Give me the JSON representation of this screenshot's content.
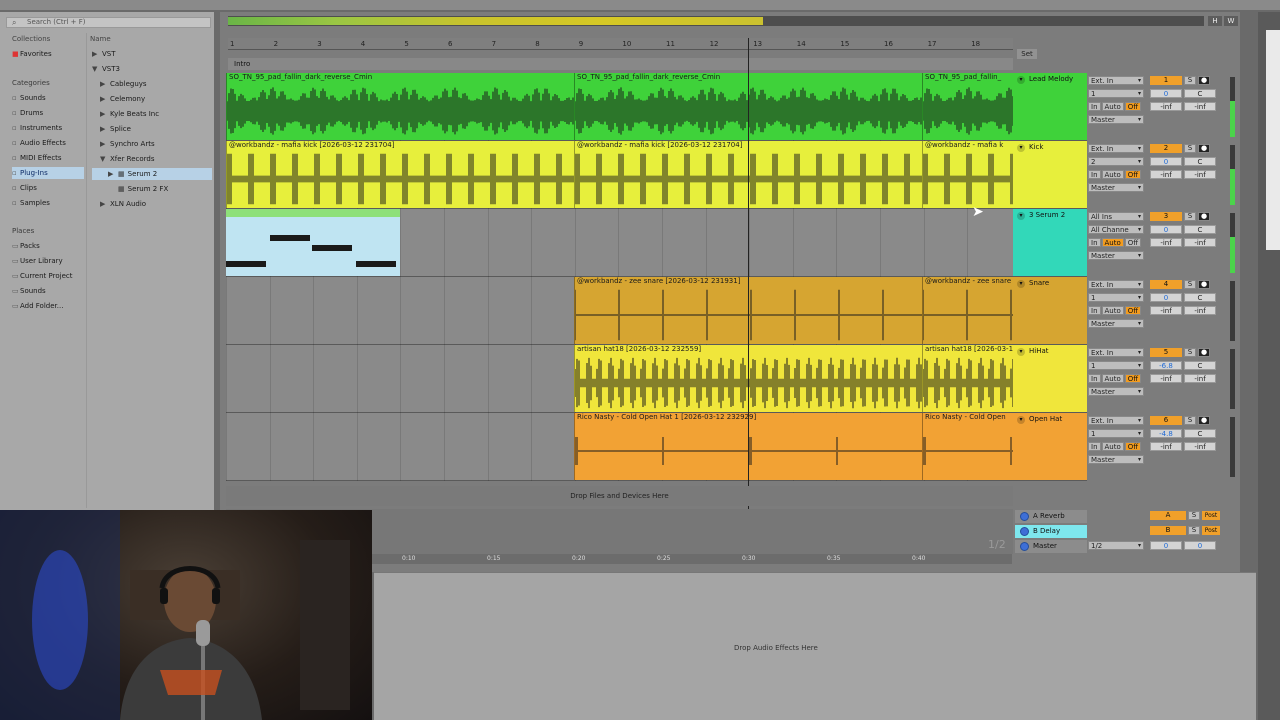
{
  "window": {
    "title": ""
  },
  "browser": {
    "search_placeholder": "Search (Ctrl + F)",
    "collections_label": "Collections",
    "name_column": "Name",
    "favorites": "Favorites",
    "categories_label": "Categories",
    "categories": [
      "Sounds",
      "Drums",
      "Instruments",
      "Audio Effects",
      "MIDI Effects",
      "Plug-Ins",
      "Clips",
      "Samples"
    ],
    "selected_category": "Plug-Ins",
    "places_label": "Places",
    "places": [
      "Packs",
      "User Library",
      "Current Project",
      "Sounds",
      "Add Folder..."
    ],
    "tree": [
      {
        "label": "VST",
        "indent": 0,
        "arrow": "▶"
      },
      {
        "label": "VST3",
        "indent": 0,
        "arrow": "▼"
      },
      {
        "label": "Cableguys",
        "indent": 1,
        "arrow": "▶"
      },
      {
        "label": "Celemony",
        "indent": 1,
        "arrow": "▶"
      },
      {
        "label": "Kyle Beats Inc",
        "indent": 1,
        "arrow": "▶"
      },
      {
        "label": "Splice",
        "indent": 1,
        "arrow": "▶"
      },
      {
        "label": "Synchro Arts",
        "indent": 1,
        "arrow": "▶"
      },
      {
        "label": "Xfer Records",
        "indent": 1,
        "arrow": "▼"
      },
      {
        "label": "Serum 2",
        "indent": 2,
        "arrow": "▶"
      },
      {
        "label": "Serum 2 FX",
        "indent": 2,
        "arrow": ""
      },
      {
        "label": "XLN Audio",
        "indent": 1,
        "arrow": "▶"
      }
    ]
  },
  "arrangement": {
    "bars": [
      "1",
      "2",
      "3",
      "4",
      "5",
      "6",
      "7",
      "8",
      "9",
      "10",
      "11",
      "12",
      "13",
      "14",
      "15",
      "16",
      "17",
      "18"
    ],
    "locator": "Intro",
    "set_label": "Set",
    "drop_files": "Drop Files and Devices Here",
    "page_indicator": "1/2",
    "overview_buttons": [
      "H",
      "W"
    ]
  },
  "tracks": [
    {
      "name": "Lead Melody",
      "num": "1",
      "color": "#3fd23a",
      "input": "Ext. In",
      "channel": "1",
      "output": "Master",
      "vol": "0",
      "pan": "C",
      "send": "-inf",
      "clips": [
        {
          "label": "SO_TN_95_pad_fallin_dark_reverse_Cmin",
          "start": 0,
          "end": 348
        },
        {
          "label": "SO_TN_95_pad_fallin_dark_reverse_Cmin",
          "start": 348,
          "end": 696
        },
        {
          "label": "SO_TN_95_pad_fallin_",
          "start": 696,
          "end": 787
        }
      ],
      "wave": "pad"
    },
    {
      "name": "Kick",
      "num": "2",
      "color": "#e7ef3c",
      "input": "Ext. In",
      "channel": "2",
      "output": "Master",
      "vol": "0",
      "pan": "C",
      "send": "-inf",
      "clips": [
        {
          "label": "@workbandz - mafia kick [2026-03-12 231704]",
          "start": 0,
          "end": 348
        },
        {
          "label": "@workbandz - mafia kick [2026-03-12 231704]",
          "start": 348,
          "end": 696
        },
        {
          "label": "@workbandz - mafia k",
          "start": 696,
          "end": 787
        }
      ],
      "wave": "kick"
    },
    {
      "name": "3 Serum 2",
      "num": "3",
      "color": "#32d8b9",
      "input": "All Ins",
      "channel": "All Channe",
      "output": "Master",
      "vol": "0",
      "pan": "C",
      "send": "-inf",
      "clips": [],
      "wave": "midi"
    },
    {
      "name": "Snare",
      "num": "4",
      "color": "#d6a531",
      "input": "Ext. In",
      "channel": "1",
      "output": "Master",
      "vol": "0",
      "pan": "C",
      "send": "-inf",
      "clips": [
        {
          "label": "@workbandz - zee snare [2026-03-12 231931]",
          "start": 348,
          "end": 696
        },
        {
          "label": "@workbandz - zee snare",
          "start": 696,
          "end": 787
        }
      ],
      "wave": "snare"
    },
    {
      "name": "HiHat",
      "num": "5",
      "color": "#f0e63b",
      "input": "Ext. In",
      "channel": "1",
      "output": "Master",
      "vol": "-6.8",
      "pan": "C",
      "send": "-inf",
      "clips": [
        {
          "label": "artisan hat18 [2026-03-12 232559]",
          "start": 348,
          "end": 696
        },
        {
          "label": "artisan hat18 [2026-03-12",
          "start": 696,
          "end": 787
        }
      ],
      "wave": "hat"
    },
    {
      "name": "Open Hat",
      "num": "6",
      "color": "#f2a234",
      "input": "Ext. In",
      "channel": "1",
      "output": "Master",
      "vol": "-4.8",
      "pan": "C",
      "send": "-inf",
      "clips": [
        {
          "label": "Rico Nasty - Cold Open Hat 1 [2026-03-12 232929]",
          "start": 348,
          "end": 696
        },
        {
          "label": "Rico Nasty - Cold Open",
          "start": 696,
          "end": 787
        }
      ],
      "wave": "ohat"
    }
  ],
  "returns": [
    {
      "name": "A Reverb",
      "letter": "A",
      "post": "Post"
    },
    {
      "name": "B Delay",
      "letter": "B",
      "post": "Post"
    },
    {
      "name": "Master",
      "letter": "",
      "post": ""
    }
  ],
  "master": {
    "cue": "1/2",
    "vol": "0",
    "pan": "0"
  },
  "timeline": [
    "0:10",
    "0:15",
    "0:20",
    "0:25",
    "0:30",
    "0:35",
    "0:40"
  ],
  "detail": {
    "drop_text": "Drop Audio Effects Here"
  },
  "mixer_labels": {
    "solo": "S",
    "auto": "Auto",
    "off": "Off",
    "in": "In",
    "inf": "-inf"
  }
}
